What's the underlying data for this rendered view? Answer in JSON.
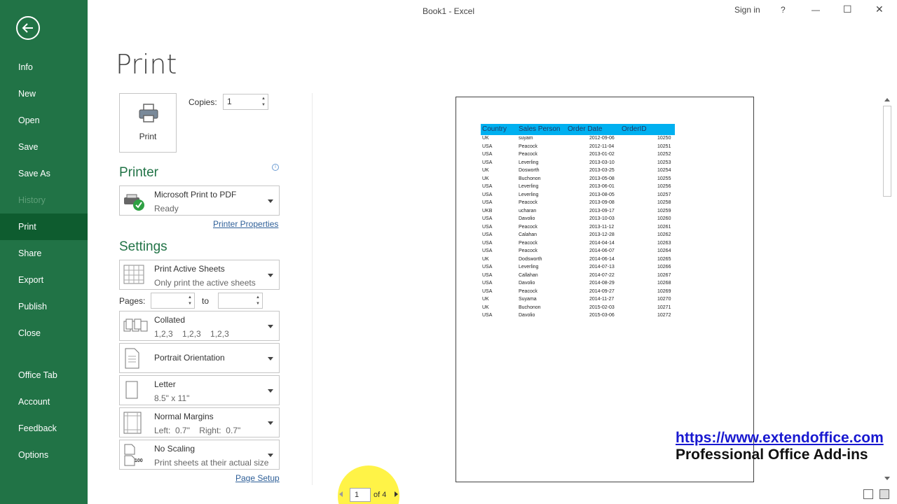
{
  "window": {
    "title": "Book1  -  Excel",
    "sign_in": "Sign in",
    "help": "?",
    "minimize": "—",
    "maximize": "☐",
    "close": "✕"
  },
  "sidebar": {
    "items": [
      {
        "label": "Info",
        "state": "normal"
      },
      {
        "label": "New",
        "state": "normal"
      },
      {
        "label": "Open",
        "state": "normal"
      },
      {
        "label": "Save",
        "state": "normal"
      },
      {
        "label": "Save As",
        "state": "normal"
      },
      {
        "label": "History",
        "state": "disabled"
      },
      {
        "label": "Print",
        "state": "active"
      },
      {
        "label": "Share",
        "state": "normal"
      },
      {
        "label": "Export",
        "state": "normal"
      },
      {
        "label": "Publish",
        "state": "normal"
      },
      {
        "label": "Close",
        "state": "normal"
      },
      {
        "label": "Office Tab",
        "state": "normal"
      },
      {
        "label": "Account",
        "state": "normal"
      },
      {
        "label": "Feedback",
        "state": "normal"
      },
      {
        "label": "Options",
        "state": "normal"
      }
    ]
  },
  "print": {
    "heading": "Print",
    "button_label": "Print",
    "copies_label": "Copies:",
    "copies_value": "1"
  },
  "printer": {
    "section_title": "Printer",
    "name": "Microsoft Print to PDF",
    "status": "Ready",
    "properties_link": "Printer Properties",
    "info": "i"
  },
  "settings": {
    "section_title": "Settings",
    "what": {
      "title": "Print Active Sheets",
      "sub": "Only print the active sheets"
    },
    "pages_label": "Pages:",
    "to_label": "to",
    "pages_from": "",
    "pages_to": "",
    "collation": {
      "title": "Collated",
      "sub": "1,2,3    1,2,3    1,2,3"
    },
    "orientation": {
      "title": "Portrait Orientation"
    },
    "paper": {
      "title": "Letter",
      "sub": "8.5\" x 11\""
    },
    "margins": {
      "title": "Normal Margins",
      "sub": "Left:  0.7\"    Right:  0.7\""
    },
    "scaling": {
      "title": "No Scaling",
      "sub": "Print sheets at their actual size",
      "icon_text": "100"
    },
    "page_setup_link": "Page Setup"
  },
  "preview": {
    "headers": [
      "Country",
      "Sales Person",
      "Order Date",
      "OrderID"
    ],
    "rows": [
      [
        "UK",
        "suyam",
        "2012-09-06",
        "10250"
      ],
      [
        "USA",
        "Peacock",
        "2012-11-04",
        "10251"
      ],
      [
        "USA",
        "Peacock",
        "2013-01-02",
        "10252"
      ],
      [
        "USA",
        "Leverling",
        "2013-03-10",
        "10253"
      ],
      [
        "UK",
        "Dosworth",
        "2013-03-25",
        "10254"
      ],
      [
        "UK",
        "Buchonon",
        "2013-05-08",
        "10255"
      ],
      [
        "USA",
        "Leverling",
        "2013-06-01",
        "10256"
      ],
      [
        "USA",
        "Leverling",
        "2013-08-05",
        "10257"
      ],
      [
        "USA",
        "Peacock",
        "2013-09-08",
        "10258"
      ],
      [
        "UKB",
        "ucharan",
        "2013-09-17",
        "10259"
      ],
      [
        "USA",
        "Davolio",
        "2013-10-03",
        "10260"
      ],
      [
        "USA",
        "Peacock",
        "2013-11-12",
        "10261"
      ],
      [
        "USA",
        "Calahan",
        "2013-12-28",
        "10262"
      ],
      [
        "USA",
        "Peacock",
        "2014-04-14",
        "10263"
      ],
      [
        "USA",
        "Peacock",
        "2014-06-07",
        "10264"
      ],
      [
        "UK",
        "Dodsworth",
        "2014-06-14",
        "10265"
      ],
      [
        "USA",
        "Leverling",
        "2014-07-13",
        "10266"
      ],
      [
        "USA",
        "Callahan",
        "2014-07-22",
        "10267"
      ],
      [
        "USA",
        "Davolio",
        "2014-08-29",
        "10268"
      ],
      [
        "USA",
        "Peacock",
        "2014-09-27",
        "10269"
      ],
      [
        "UK",
        "Suyama",
        "2014-11-27",
        "10270"
      ],
      [
        "UK",
        "Buchonon",
        "2015-02-03",
        "10271"
      ],
      [
        "USA",
        "Davolio",
        "2015-03-06",
        "10272"
      ]
    ],
    "current_page": "1",
    "page_of": "of 4",
    "header_color": "#00b0f0"
  },
  "watermark": {
    "url": "https://www.extendoffice.com",
    "tagline": "Professional Office Add-ins"
  },
  "colors": {
    "accent": "#217346",
    "active_nav": "#0e5c2f",
    "link": "#2e5f98"
  }
}
